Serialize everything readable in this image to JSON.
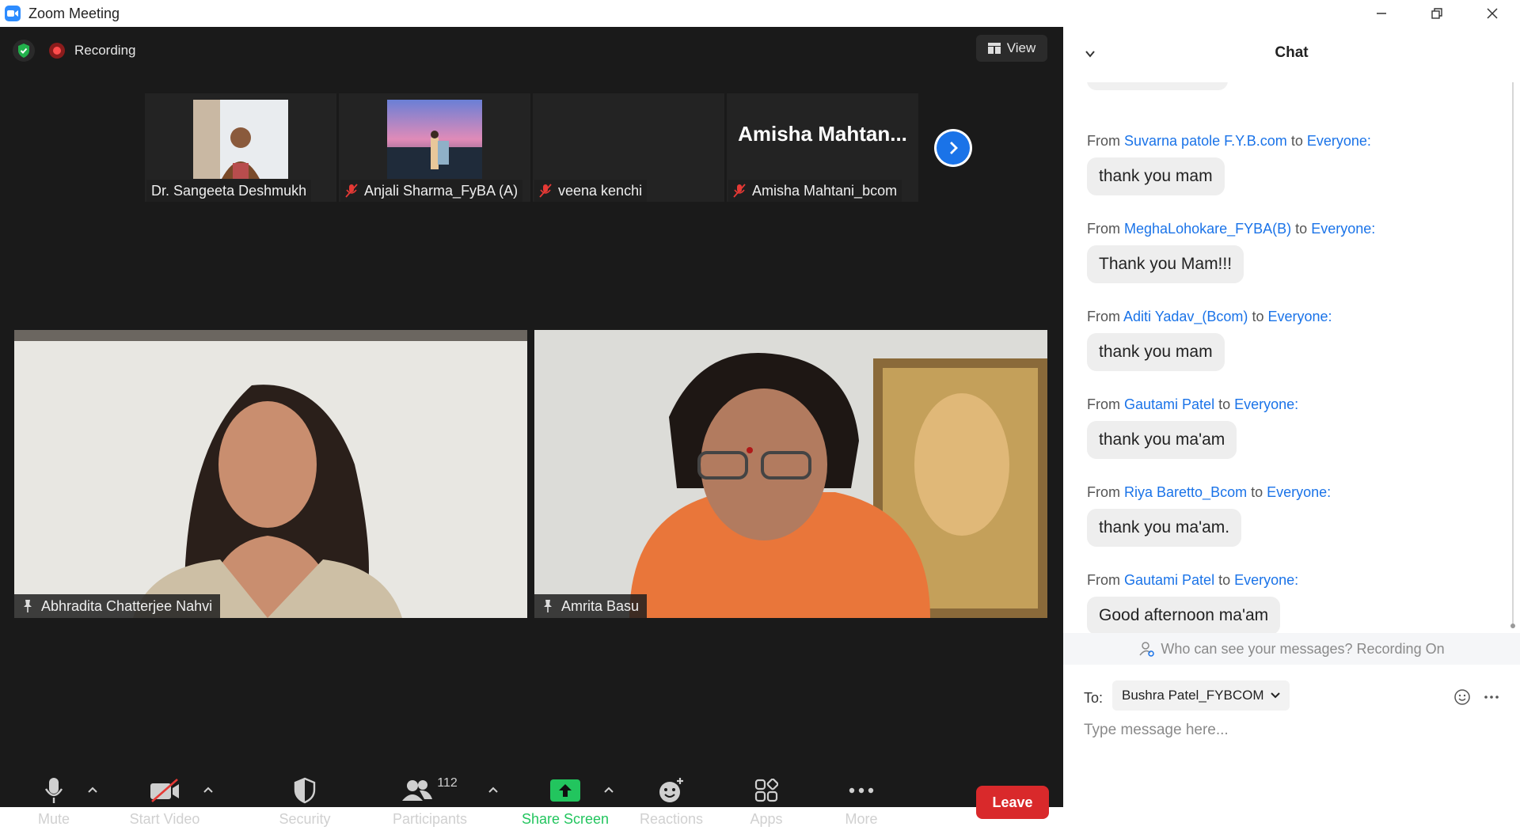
{
  "window": {
    "title": "Zoom Meeting"
  },
  "meeting": {
    "recording_label": "Recording",
    "view_label": "View",
    "strip": [
      {
        "name": "Dr. Sangeeta Deshmukh",
        "muted": false,
        "has_video": true
      },
      {
        "name": "Anjali Sharma_FyBA (A)",
        "muted": true,
        "has_video": true
      },
      {
        "name": "veena kenchi",
        "muted": true,
        "has_video": false
      },
      {
        "name": "Amisha Mahtani_bcom",
        "display_name": "Amisha  Mahtan...",
        "muted": true,
        "has_video": false
      }
    ],
    "videos": [
      {
        "name": "Abhradita Chatterjee Nahvi"
      },
      {
        "name": "Amrita Basu"
      }
    ]
  },
  "toolbar": {
    "mute_label": "Mute",
    "start_video_label": "Start Video",
    "security_label": "Security",
    "participants_label": "Participants",
    "participants_count": "112",
    "share_screen_label": "Share Screen",
    "reactions_label": "Reactions",
    "apps_label": "Apps",
    "more_label": "More",
    "leave_label": "Leave"
  },
  "chat": {
    "title": "Chat",
    "messages": [
      {
        "prefix": "From",
        "sender": "Suvarna patole F.Y.B.com",
        "to_word": "to",
        "recipient": "Everyone:",
        "text": "thank you mam"
      },
      {
        "prefix": "From",
        "sender": "MeghaLohokare_FYBA(B)",
        "to_word": "to",
        "recipient": "Everyone:",
        "text": "Thank you Mam!!!"
      },
      {
        "prefix": "From",
        "sender": "Aditi Yadav_(Bcom)",
        "to_word": "to",
        "recipient": "Everyone:",
        "text": "thank you mam"
      },
      {
        "prefix": "From",
        "sender": "Gautami Patel",
        "to_word": "to",
        "recipient": "Everyone:",
        "text": "thank you ma'am"
      },
      {
        "prefix": "From",
        "sender": "Riya Baretto_Bcom",
        "to_word": "to",
        "recipient": "Everyone:",
        "text": "thank you ma'am."
      },
      {
        "prefix": "From",
        "sender": "Gautami Patel",
        "to_word": "to",
        "recipient": "Everyone:",
        "text": "Good afternoon ma'am"
      }
    ],
    "visibility_notice": "Who can see your messages? Recording On",
    "to_label": "To:",
    "recipient": "Bushra Patel_FYBCOM",
    "input_placeholder": "Type message here..."
  },
  "colors": {
    "accent": "#1a73e8",
    "leave": "#d9292b",
    "share": "#22c55e",
    "meeting_bg": "#1a1a1a"
  }
}
